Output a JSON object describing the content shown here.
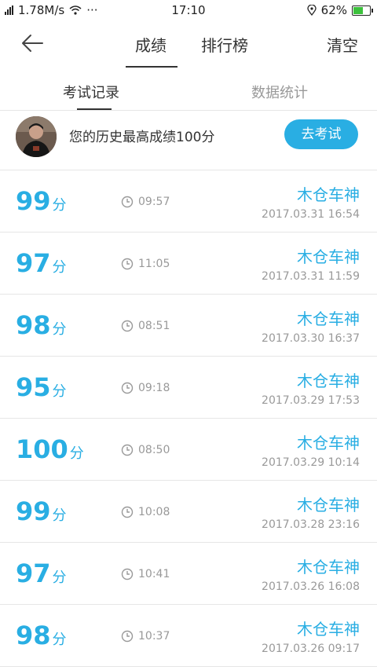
{
  "status_bar": {
    "speed": "1.78M/s",
    "dots": "···",
    "time": "17:10",
    "battery": "62%",
    "battery_level": 0.62
  },
  "nav": {
    "tabs": [
      {
        "label": "成绩"
      },
      {
        "label": "排行榜"
      }
    ],
    "active_tab": "成绩",
    "clear_label": "清空"
  },
  "subtabs": [
    {
      "label": "考试记录"
    },
    {
      "label": "数据统计"
    }
  ],
  "best": {
    "text": "您的历史最高成绩100分",
    "button_label": "去考试"
  },
  "records": [
    {
      "score": "99",
      "unit": "分",
      "duration": "09:57",
      "name": "木仓车神",
      "date": "2017.03.31   16:54"
    },
    {
      "score": "97",
      "unit": "分",
      "duration": "11:05",
      "name": "木仓车神",
      "date": "2017.03.31   11:59"
    },
    {
      "score": "98",
      "unit": "分",
      "duration": "08:51",
      "name": "木仓车神",
      "date": "2017.03.30   16:37"
    },
    {
      "score": "95",
      "unit": "分",
      "duration": "09:18",
      "name": "木仓车神",
      "date": "2017.03.29   17:53"
    },
    {
      "score": "100",
      "unit": "分",
      "duration": "08:50",
      "name": "木仓车神",
      "date": "2017.03.29   10:14"
    },
    {
      "score": "99",
      "unit": "分",
      "duration": "10:08",
      "name": "木仓车神",
      "date": "2017.03.28   23:16"
    },
    {
      "score": "97",
      "unit": "分",
      "duration": "10:41",
      "name": "木仓车神",
      "date": "2017.03.26   16:08"
    },
    {
      "score": "98",
      "unit": "分",
      "duration": "10:37",
      "name": "木仓车神",
      "date": "2017.03.26   09:17"
    }
  ],
  "colors": {
    "accent": "#29aee3",
    "battery_fill": "#3cc13c"
  }
}
